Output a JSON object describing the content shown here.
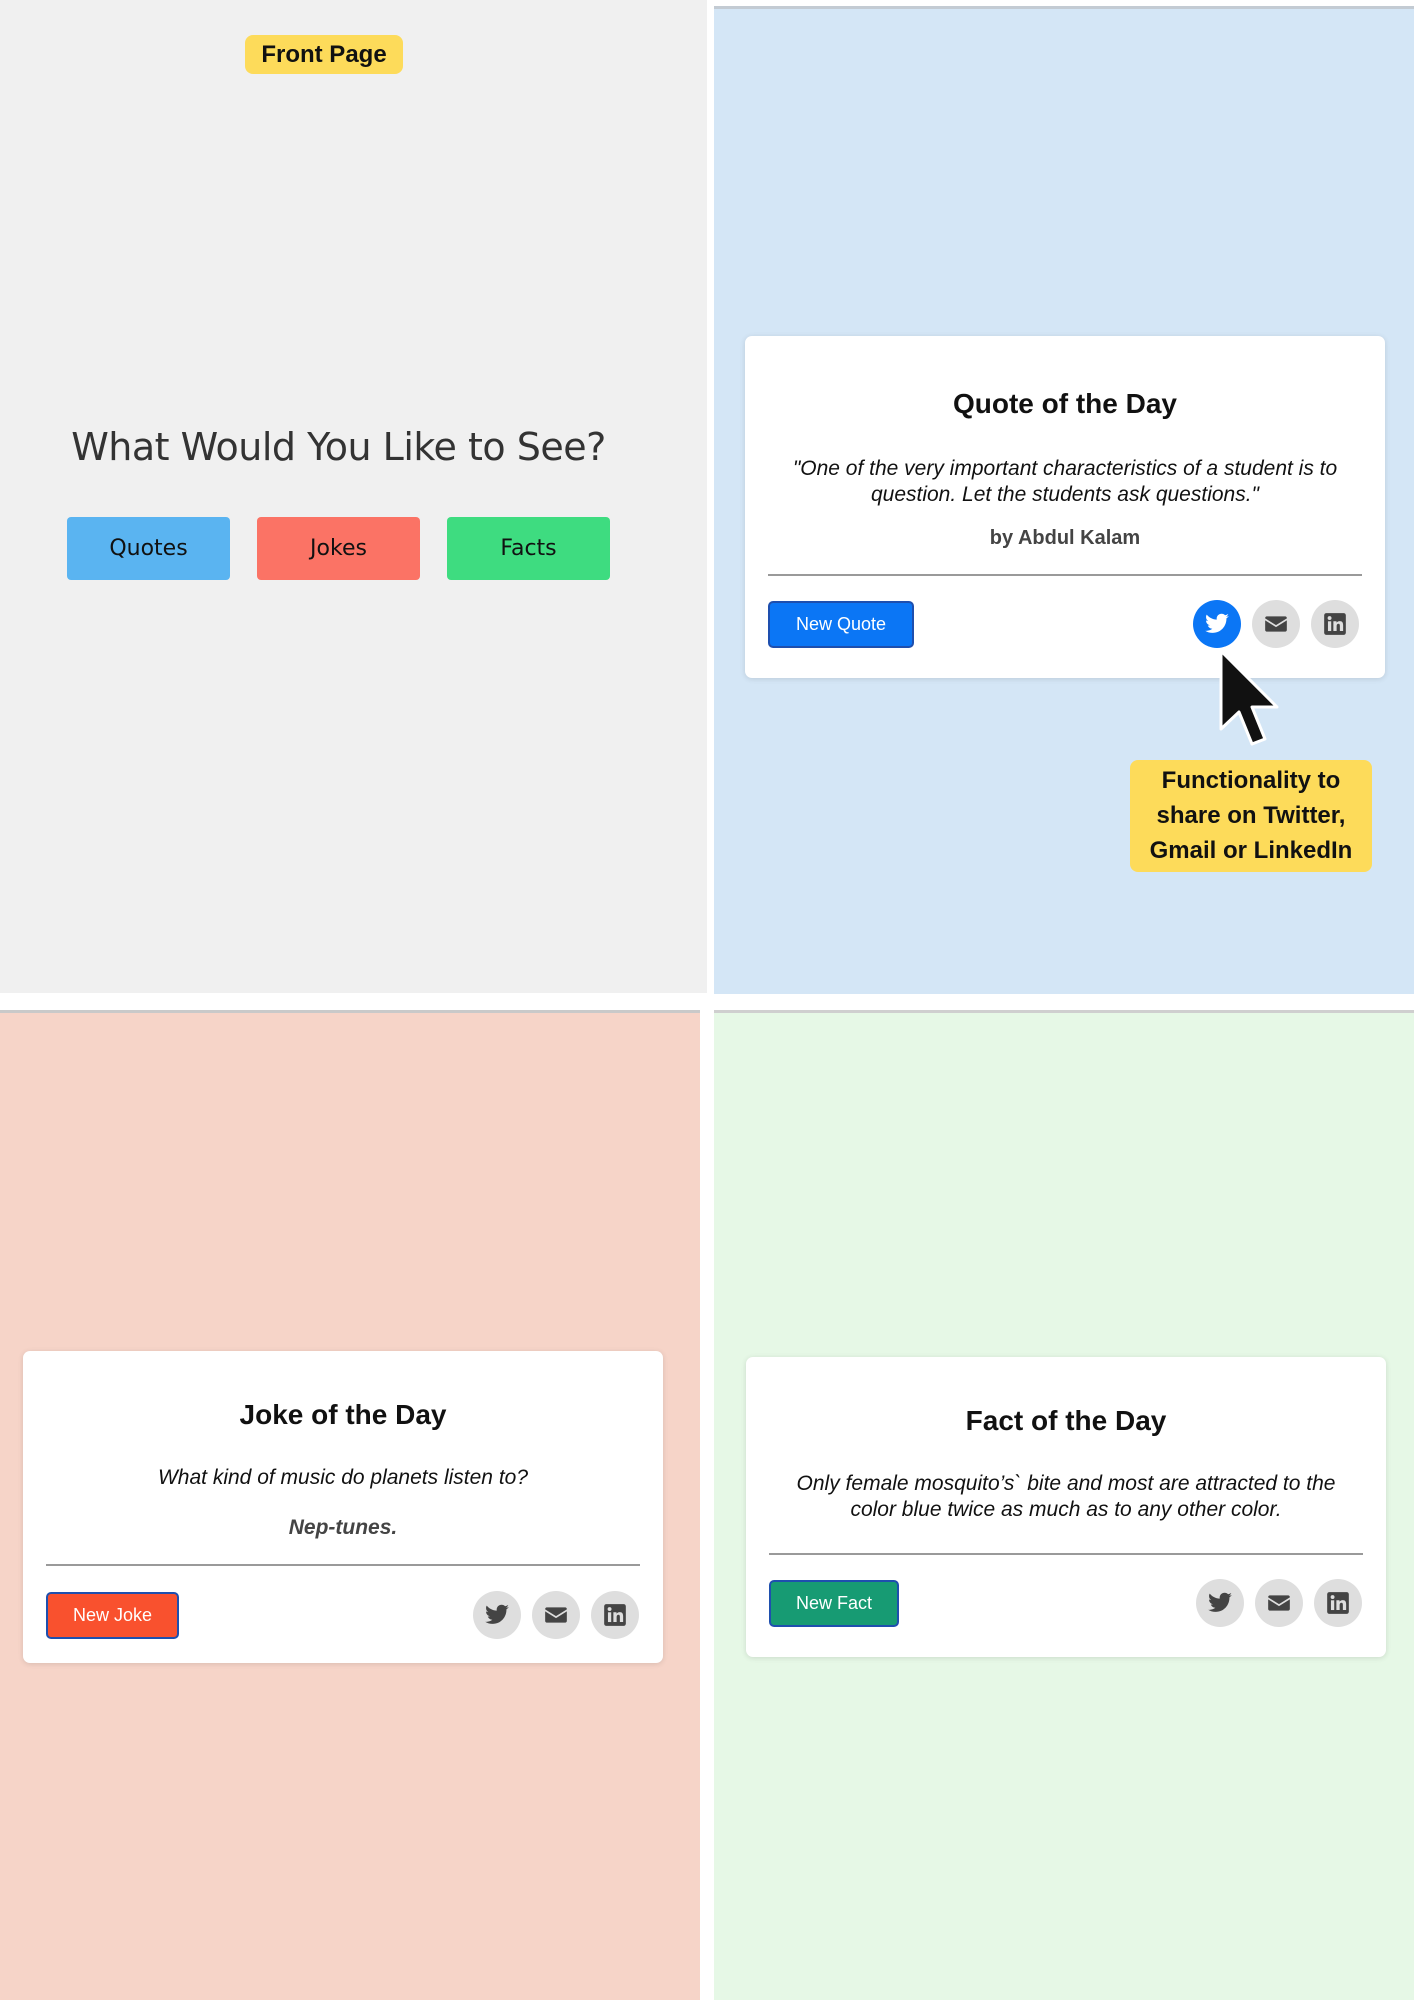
{
  "front_page": {
    "tag": "Front Page",
    "heading": "What Would You Like to See?",
    "buttons": {
      "quotes": "Quotes",
      "jokes": "Jokes",
      "facts": "Facts"
    }
  },
  "quote_page": {
    "title": "Quote of the Day",
    "text": "\"One of the very important characteristics of a student is to question. Let the students ask questions.\"",
    "author": "by Abdul Kalam",
    "button": "New Quote",
    "annotation": "Functionality to share on Twitter, Gmail or LinkedIn"
  },
  "joke_page": {
    "title": "Joke of the Day",
    "question": "What kind of music do planets listen to?",
    "answer": "Nep-tunes.",
    "button": "New Joke"
  },
  "fact_page": {
    "title": "Fact of the Day",
    "text": "Only female mosquito’s` bite and most are attracted to the color blue twice as much as to any other color.",
    "button": "New Fact"
  },
  "share_icons": [
    "twitter-icon",
    "mail-icon",
    "linkedin-icon"
  ],
  "colors": {
    "quotes": "#5ab4f1",
    "jokes": "#fb7365",
    "facts": "#3edc80",
    "new_quote": "#0b76f5",
    "new_joke": "#f9512e",
    "new_fact": "#179b73",
    "highlight": "#fddb5a"
  }
}
